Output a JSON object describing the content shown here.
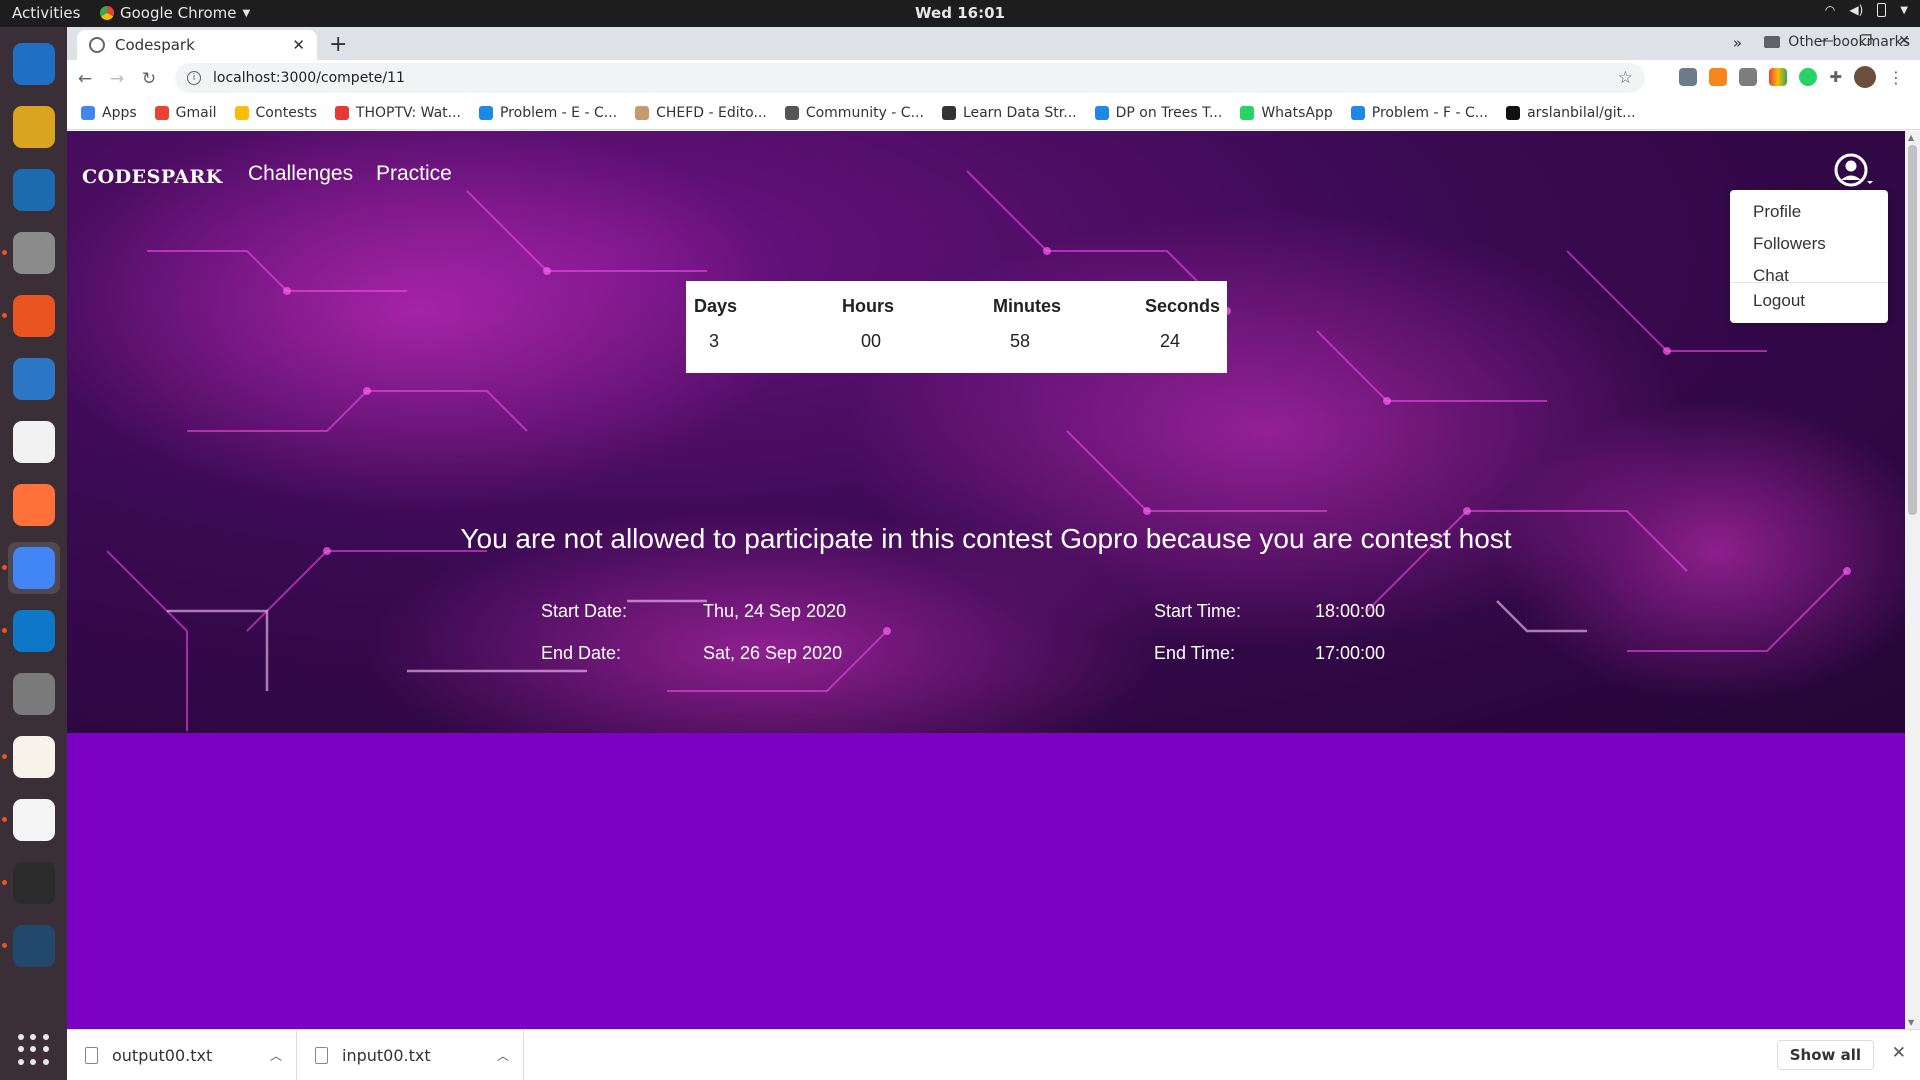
{
  "topbar": {
    "activities": "Activities",
    "app_name": "Google Chrome",
    "clock": "Wed 16:01"
  },
  "dock": {
    "apps": [
      {
        "name": "thunderbird-icon",
        "color": "#1f6fc4"
      },
      {
        "name": "rhythmbox-icon",
        "color": "#d9a521"
      },
      {
        "name": "writer-icon",
        "color": "#1c6ab0"
      },
      {
        "name": "files-icon",
        "color": "#8b8b8b"
      },
      {
        "name": "software-icon",
        "color": "#e95420"
      },
      {
        "name": "help-icon",
        "color": "#2b77c6"
      },
      {
        "name": "amazon-icon",
        "color": "#f2f2f2"
      },
      {
        "name": "firefox-icon",
        "color": "#ff7139"
      },
      {
        "name": "chrome-icon",
        "color": "#4285f4"
      },
      {
        "name": "vscode-icon",
        "color": "#0e77c7"
      },
      {
        "name": "settings-icon",
        "color": "#7a7a7a"
      },
      {
        "name": "text-editor-icon",
        "color": "#f7f3e8"
      },
      {
        "name": "pdf-icon",
        "color": "#f5f5f5"
      },
      {
        "name": "terminal-icon",
        "color": "#2b2b2b"
      },
      {
        "name": "mysql-workbench-icon",
        "color": "#22486c"
      }
    ]
  },
  "browser": {
    "tab_title": "Codespark",
    "url": "localhost:3000/compete/11",
    "bookmarks": [
      {
        "label": "Apps",
        "color": "#4285f4"
      },
      {
        "label": "Gmail",
        "color": "#ea4335"
      },
      {
        "label": "Contests",
        "color": "#fbbc05"
      },
      {
        "label": "THOPTV: Wat...",
        "color": "#e53935"
      },
      {
        "label": "Problem - E - C...",
        "color": "#1e88e5"
      },
      {
        "label": "CHEFD - Edito...",
        "color": "#c59b6d"
      },
      {
        "label": "Community - C...",
        "color": "#555555"
      },
      {
        "label": "Learn Data Str...",
        "color": "#333333"
      },
      {
        "label": "DP on Trees T...",
        "color": "#1e88e5"
      },
      {
        "label": "WhatsApp",
        "color": "#25d366"
      },
      {
        "label": "Problem - F - C...",
        "color": "#1e88e5"
      },
      {
        "label": "arslanbilal/git...",
        "color": "#111111"
      }
    ],
    "bookmarks_more": "»",
    "other_bookmarks": "Other bookmarks"
  },
  "page": {
    "brand": "CODESPARK",
    "nav": [
      "Challenges",
      "Practice"
    ],
    "dropdown": [
      "Profile",
      "Followers",
      "Chat",
      "Logout"
    ],
    "timer": {
      "headers": [
        "Days",
        "Hours",
        "Minutes",
        "Seconds"
      ],
      "values": [
        "3",
        "00",
        "58",
        "24"
      ]
    },
    "message": "You are not allowed to participate in this contest Gopro because you are contest host",
    "schedule": {
      "start_date_label": "Start Date:",
      "start_date": "Thu, 24 Sep 2020",
      "end_date_label": "End Date:",
      "end_date": "Sat, 26 Sep 2020",
      "start_time_label": "Start Time:",
      "start_time": "18:00:00",
      "end_time_label": "End Time:",
      "end_time": "17:00:00"
    },
    "colors": {
      "lower_background": "#7d00c5",
      "hero_glow": "#ff3ce6"
    }
  },
  "downloads": {
    "files": [
      "output00.txt",
      "input00.txt"
    ],
    "show_all": "Show all"
  }
}
